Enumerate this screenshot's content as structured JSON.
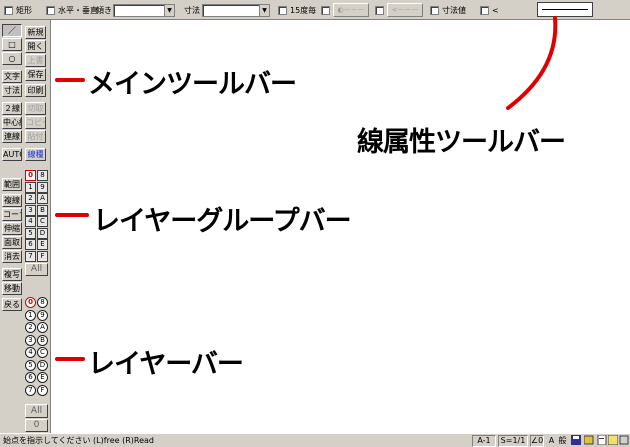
{
  "attribute_bar": {
    "rect_label": "矩形",
    "hv_label": "水平・垂直",
    "tilt_label": "傾き",
    "dim_label": "寸法",
    "deg15_label": "15度毎",
    "btn1_label": "◐－－－",
    "btn2_label": "<－－－",
    "dimval_label": "寸法値",
    "lt_label": "<"
  },
  "main_toolbar": {
    "left": [
      "／",
      "□",
      "○",
      "文字",
      "寸法",
      "２線",
      "中心線",
      "連線",
      "AUTO"
    ],
    "right": [
      "新規",
      "開く",
      "上書",
      "保存",
      "印刷",
      "切取",
      "コピー",
      "貼付",
      "線種"
    ]
  },
  "layer_group_bar": {
    "left": [
      "範囲",
      "複線",
      "コーナー",
      "伸縮",
      "面取",
      "消去",
      "複写",
      "移動",
      "戻る"
    ],
    "rows": [
      [
        "0",
        "8"
      ],
      [
        "1",
        "9"
      ],
      [
        "2",
        "A"
      ],
      [
        "3",
        "B"
      ],
      [
        "4",
        "C"
      ],
      [
        "5",
        "D"
      ],
      [
        "6",
        "E"
      ],
      [
        "7",
        "F"
      ]
    ],
    "all_label": "All"
  },
  "layer_bar": {
    "rows": [
      [
        "0",
        "8"
      ],
      [
        "1",
        "9"
      ],
      [
        "2",
        "A"
      ],
      [
        "3",
        "B"
      ],
      [
        "4",
        "C"
      ],
      [
        "5",
        "D"
      ],
      [
        "6",
        "E"
      ],
      [
        "7",
        "F"
      ]
    ],
    "all_label": "All",
    "zero_label": "0"
  },
  "annotations": {
    "main_toolbar": "メインツールバー",
    "line_attr": "線属性ツールバー",
    "layer_group": "レイヤーグループバー",
    "layer": "レイヤーバー"
  },
  "status": {
    "message": "始点を指示してください (L)free (R)Read",
    "layer": "A-1",
    "scale": "S=1/1",
    "angle": "∠0",
    "right_icons": [
      "A",
      "般",
      "disk",
      "note",
      "doc",
      "calc",
      "exit"
    ]
  },
  "colors": {
    "annotation_red": "#e00000",
    "current_layer": "#d40000",
    "linetype_blue": "#1e2fd0"
  }
}
